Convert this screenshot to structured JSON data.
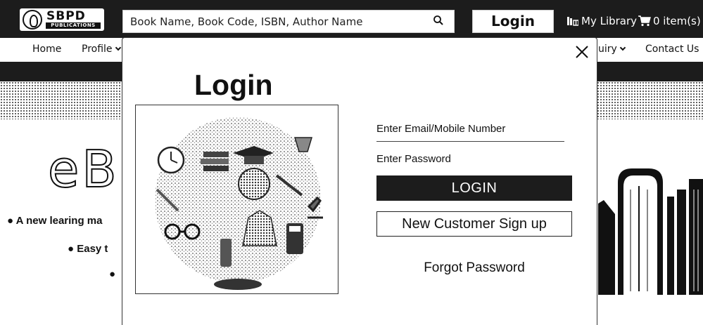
{
  "header": {
    "logo_main": "SBPD",
    "logo_sub": "PUBLICATIONS",
    "search": {
      "placeholder": "Book Name, Book Code, ISBN, Author Name",
      "icon": "search-icon"
    },
    "login_label": "Login",
    "my_library_label": "My Library",
    "cart_label": "0 item(s)"
  },
  "nav": {
    "items": [
      {
        "label": "Home",
        "dropdown": false
      },
      {
        "label": "Profile",
        "dropdown": true
      },
      {
        "label": "uiry",
        "dropdown": true
      },
      {
        "label": "Contact Us",
        "dropdown": false
      }
    ]
  },
  "hero": {
    "title_partial": "eB",
    "lines": [
      "● A new learing ma",
      "● Easy t",
      "●"
    ]
  },
  "modal": {
    "title": "Login",
    "email_placeholder": "Enter Email/Mobile Number",
    "password_placeholder": "Enter Password",
    "login_button": "LOGIN",
    "signup_button": "New Customer Sign up",
    "forgot_link": "Forgot Password",
    "close_icon": "close-icon",
    "illustration": "education-doodle-circle"
  },
  "colors": {
    "dark": "#1c1c1c",
    "light": "#ffffff"
  }
}
